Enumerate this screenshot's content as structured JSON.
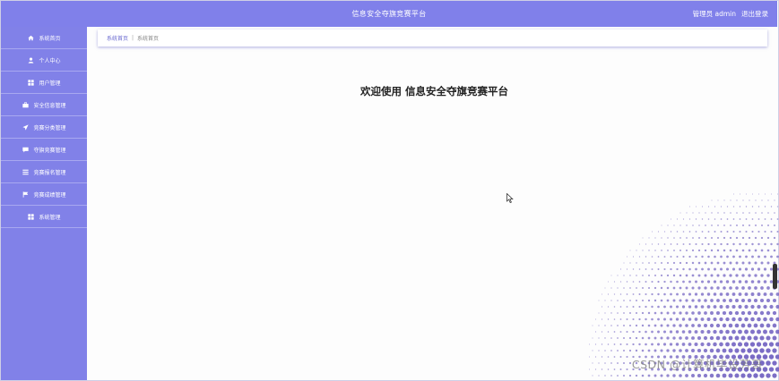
{
  "header": {
    "title": "信息安全夺旗竞赛平台",
    "user_label": "管理员 admin",
    "logout_label": "退出登录"
  },
  "sidebar": {
    "items": [
      {
        "label": "系统首页",
        "icon": "home-icon"
      },
      {
        "label": "个人中心",
        "icon": "user-icon"
      },
      {
        "label": "用户管理",
        "icon": "grid-icon"
      },
      {
        "label": "安全信息管理",
        "icon": "briefcase-icon"
      },
      {
        "label": "竞赛分类管理",
        "icon": "send-icon"
      },
      {
        "label": "夺旗竞赛管理",
        "icon": "chat-icon"
      },
      {
        "label": "竞赛报名管理",
        "icon": "list-icon"
      },
      {
        "label": "竞赛成绩管理",
        "icon": "flag-icon"
      },
      {
        "label": "系统管理",
        "icon": "grid-icon"
      }
    ]
  },
  "breadcrumb": {
    "home": "系统首页",
    "separator": "|",
    "current": "系统首页"
  },
  "main": {
    "welcome": "欢迎使用 信息安全夺旗竞赛平台"
  },
  "watermark": "CSDN @计算机毕设芳哥",
  "colors": {
    "accent": "#8080ea",
    "dots": "#6f5fc0"
  }
}
